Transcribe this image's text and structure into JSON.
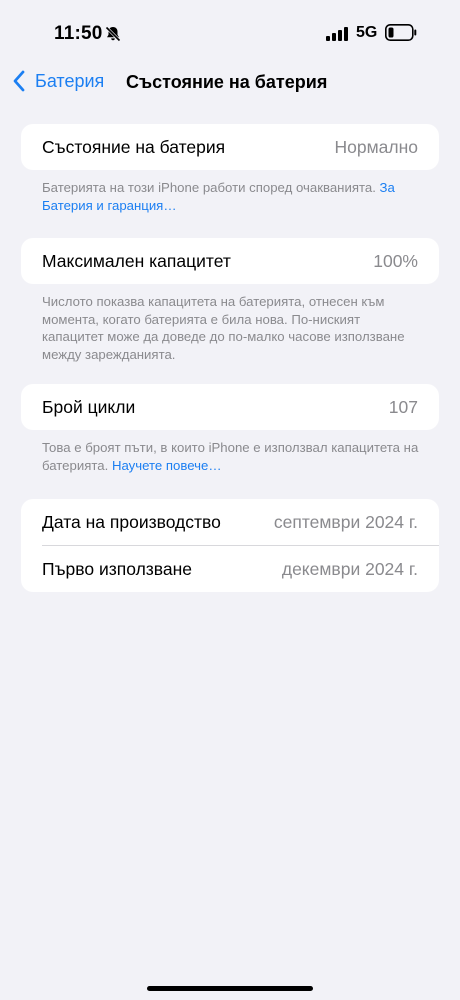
{
  "status_bar": {
    "time": "11:50",
    "network": "5G",
    "icons": [
      "bell-slash-icon",
      "signal-bars-icon",
      "battery-icon"
    ]
  },
  "nav": {
    "back_label": "Батерия",
    "title": "Състояние на батерия"
  },
  "battery_health": {
    "label": "Състояние на батерия",
    "value": "Нормално",
    "note": "Батерията на този iPhone работи според очакванията.",
    "link": "За Батерия и гаранция…"
  },
  "max_capacity": {
    "label": "Максимален капацитет",
    "value": "100%",
    "note": "Числото показва капацитета на батерията, отнесен към момента, когато батерията е била нова. По-ниският капацитет може да доведе до по-малко часове използване между зарежданията."
  },
  "cycle_count": {
    "label": "Брой цикли",
    "value": "107",
    "note": "Това е броят пъти, в които iPhone е използвал капацитета на батерията.",
    "link": "Научете повече…"
  },
  "dates": {
    "manufacture_label": "Дата на производство",
    "manufacture_value": "септември 2024 г.",
    "first_use_label": "Първо използване",
    "first_use_value": "декември 2024 г."
  },
  "colors": {
    "background": "#f2f2f7",
    "accent": "#1c7ff2",
    "secondary_text": "#8a8a8e"
  }
}
